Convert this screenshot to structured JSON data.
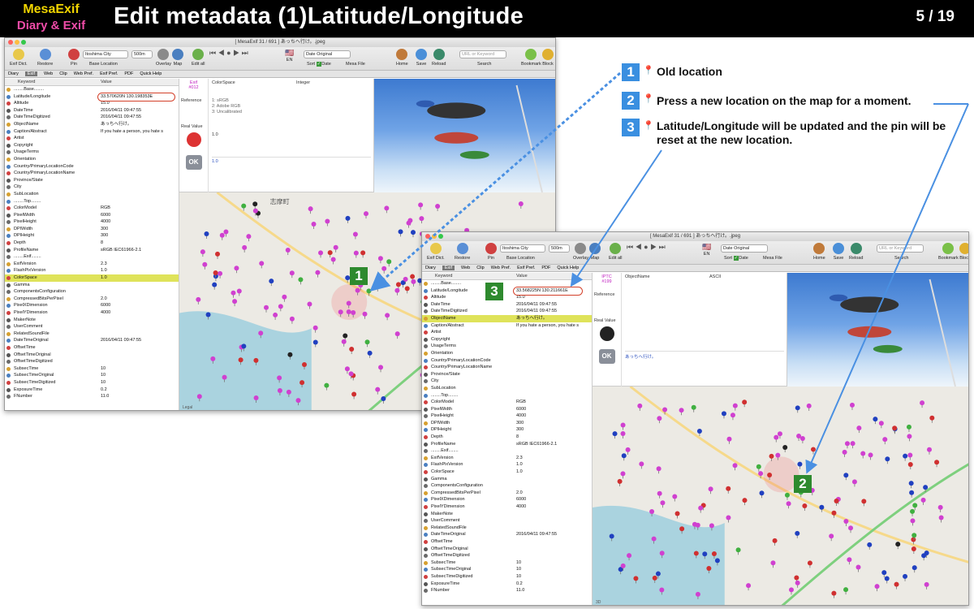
{
  "slide": {
    "brand_line1": "MesaExif",
    "brand_line2": "Diary & Exif",
    "title": "Edit metadata (1)Latitude/Longitude",
    "pager": "5 / 19"
  },
  "annotations": [
    {
      "num": "1",
      "text": "Old location"
    },
    {
      "num": "2",
      "text": "Press a new location on the map for a moment."
    },
    {
      "num": "3",
      "text": "Latitude/Longitude will be updated and the pin will be reset at the new location."
    }
  ],
  "colors": {
    "badge_blue": "#3a8fe0",
    "badge_green": "#2e8a2e",
    "highlight": "#dfe35a",
    "field_circle": "#d3402a"
  },
  "win1": {
    "title": "[ MesaExif 31 / 691 ]  あっちへ行け。.jpeg",
    "toolbar": {
      "exif_dict": "Exif Dict.",
      "restore": "Restore",
      "pin": "Pin",
      "location_value": "Itoshima City",
      "base_location": "Base Location",
      "zoom_value": "500m",
      "overlay": "Overlay",
      "map": "Map",
      "edit_all": "Edit all",
      "lang": "EN",
      "sort_value": "Date Original",
      "sort": "Sort",
      "date": "Date",
      "mesa_file": "Mesa File",
      "home": "Home",
      "save": "Save",
      "reload": "Reload",
      "search_placeholder": "URL or Keyword",
      "search": "Search",
      "bookmark": "Bookmark",
      "block": "Block"
    },
    "tabs": [
      "Diary",
      "Exif",
      "Web",
      "Clip",
      "Web Pref.",
      "Exif Pref.",
      "PDF",
      "Quick Help"
    ],
    "col_keyword": "Keyword",
    "col_value": "Value",
    "rows": [
      {
        "k": "........Base........",
        "v": ""
      },
      {
        "k": "Latitude/Longitude",
        "v": "33.570620N 130.198353E"
      },
      {
        "k": "Altitude",
        "v": "15.0"
      },
      {
        "k": "DateTime",
        "v": "2016/04/11 09:47:55"
      },
      {
        "k": "DateTimeDigitized",
        "v": "2016/04/11 09:47:55"
      },
      {
        "k": "ObjectName",
        "v": "あっちへ行け。"
      },
      {
        "k": "Caption/Abstract",
        "v": "If you hate a person, you hate s"
      },
      {
        "k": "Artist",
        "v": ""
      },
      {
        "k": "Copyright",
        "v": ""
      },
      {
        "k": "UsageTerms",
        "v": ""
      },
      {
        "k": "Orientation",
        "v": ""
      },
      {
        "k": "Country/PrimaryLocationCode",
        "v": ""
      },
      {
        "k": "Country/PrimaryLocationName",
        "v": ""
      },
      {
        "k": "Province/State",
        "v": ""
      },
      {
        "k": "City",
        "v": ""
      },
      {
        "k": "SubLocation",
        "v": ""
      },
      {
        "k": "........Top........",
        "v": ""
      },
      {
        "k": "ColorModel",
        "v": "RGB"
      },
      {
        "k": "PixelWidth",
        "v": "6000"
      },
      {
        "k": "PixelHeight",
        "v": "4000"
      },
      {
        "k": "DPIWidth",
        "v": "300"
      },
      {
        "k": "DPIHeight",
        "v": "300"
      },
      {
        "k": "Depth",
        "v": "8"
      },
      {
        "k": "ProfileName",
        "v": "sRGB IEC61966-2.1"
      },
      {
        "k": "........Exif........",
        "v": ""
      },
      {
        "k": "ExifVersion",
        "v": "2.3"
      },
      {
        "k": "FlashPixVersion",
        "v": "1.0"
      },
      {
        "k": "ColorSpace",
        "v": "1.0"
      },
      {
        "k": "Gamma",
        "v": ""
      },
      {
        "k": "ComponentsConfiguration",
        "v": ""
      },
      {
        "k": "CompressedBitsPerPixel",
        "v": "2.0"
      },
      {
        "k": "PixelXDimension",
        "v": "6000"
      },
      {
        "k": "PixelYDimension",
        "v": "4000"
      },
      {
        "k": "MakerNote",
        "v": ""
      },
      {
        "k": "UserComment",
        "v": ""
      },
      {
        "k": "RelatedSoundFile",
        "v": ""
      },
      {
        "k": "DateTimeOriginal",
        "v": "2016/04/11 09:47:55"
      },
      {
        "k": "OffsetTime",
        "v": ""
      },
      {
        "k": "OffsetTimeOriginal",
        "v": ""
      },
      {
        "k": "OffsetTimeDigitized",
        "v": ""
      },
      {
        "k": "SubsecTime",
        "v": "10"
      },
      {
        "k": "SubsecTimeOriginal",
        "v": "10"
      },
      {
        "k": "SubsecTimeDigitized",
        "v": "10"
      },
      {
        "k": "ExposureTime",
        "v": "0.2"
      },
      {
        "k": "FNumber",
        "v": "11.0"
      }
    ],
    "detail": {
      "section": "Exif",
      "tag": "#012",
      "field": "ColorSpace",
      "type": "Integer",
      "reference_label": "Reference",
      "reference_lines": [
        "1: sRGB",
        "2: Adobe RGB",
        "3: Uncalibrated"
      ],
      "real_value_label": "Real Value",
      "real_value": "1.0",
      "value": "1.0",
      "ok": "OK"
    },
    "map_label": "志摩町",
    "map_corner": "Legal"
  },
  "win2": {
    "title": "[ MesaExif 31 / 691 ]  あっちへ行け。.jpeg",
    "toolbar": {
      "exif_dict": "Exif Dict.",
      "restore": "Restore",
      "pin": "Pin",
      "location_value": "Itoshima City",
      "base_location": "Base Location",
      "zoom_value": "500m",
      "overlay": "Overlay",
      "map": "Map",
      "edit_all": "Edit all",
      "lang": "EN",
      "sort_value": "Date Original",
      "sort": "Sort",
      "date": "Date",
      "mesa_file": "Mesa File",
      "home": "Home",
      "save": "Save",
      "reload": "Reload",
      "search_placeholder": "URL or Keyword",
      "search": "Search",
      "bookmark": "Bookmark",
      "block": "Block"
    },
    "tabs": [
      "Diary",
      "Exif",
      "Web",
      "Clip",
      "Web Pref.",
      "Exif Pref.",
      "PDF",
      "Quick Help"
    ],
    "col_keyword": "Keyword",
    "col_value": "Value",
    "rows": [
      {
        "k": "........Base........",
        "v": ""
      },
      {
        "k": "Latitude/Longitude",
        "v": "33.568225N 130.211661E"
      },
      {
        "k": "Altitude",
        "v": "15.0"
      },
      {
        "k": "DateTime",
        "v": "2016/04/11 09:47:55"
      },
      {
        "k": "DateTimeDigitized",
        "v": "2016/04/11 09:47:55"
      },
      {
        "k": "ObjectName",
        "v": "あっちへ行け。"
      },
      {
        "k": "Caption/Abstract",
        "v": "If you hate a person, you hate s"
      },
      {
        "k": "Artist",
        "v": ""
      },
      {
        "k": "Copyright",
        "v": ""
      },
      {
        "k": "UsageTerms",
        "v": ""
      },
      {
        "k": "Orientation",
        "v": ""
      },
      {
        "k": "Country/PrimaryLocationCode",
        "v": ""
      },
      {
        "k": "Country/PrimaryLocationName",
        "v": ""
      },
      {
        "k": "Province/State",
        "v": ""
      },
      {
        "k": "City",
        "v": ""
      },
      {
        "k": "SubLocation",
        "v": ""
      },
      {
        "k": "........Top........",
        "v": ""
      },
      {
        "k": "ColorModel",
        "v": "RGB"
      },
      {
        "k": "PixelWidth",
        "v": "6000"
      },
      {
        "k": "PixelHeight",
        "v": "4000"
      },
      {
        "k": "DPIWidth",
        "v": "300"
      },
      {
        "k": "DPIHeight",
        "v": "300"
      },
      {
        "k": "Depth",
        "v": "8"
      },
      {
        "k": "ProfileName",
        "v": "sRGB IEC61966-2.1"
      },
      {
        "k": "........Exif........",
        "v": ""
      },
      {
        "k": "ExifVersion",
        "v": "2.3"
      },
      {
        "k": "FlashPixVersion",
        "v": "1.0"
      },
      {
        "k": "ColorSpace",
        "v": "1.0"
      },
      {
        "k": "Gamma",
        "v": ""
      },
      {
        "k": "ComponentsConfiguration",
        "v": ""
      },
      {
        "k": "CompressedBitsPerPixel",
        "v": "2.0"
      },
      {
        "k": "PixelXDimension",
        "v": "6000"
      },
      {
        "k": "PixelYDimension",
        "v": "4000"
      },
      {
        "k": "MakerNote",
        "v": ""
      },
      {
        "k": "UserComment",
        "v": ""
      },
      {
        "k": "RelatedSoundFile",
        "v": ""
      },
      {
        "k": "DateTimeOriginal",
        "v": "2016/04/11 09:47:55"
      },
      {
        "k": "OffsetTime",
        "v": ""
      },
      {
        "k": "OffsetTimeOriginal",
        "v": ""
      },
      {
        "k": "OffsetTimeDigitized",
        "v": ""
      },
      {
        "k": "SubsecTime",
        "v": "10"
      },
      {
        "k": "SubsecTimeOriginal",
        "v": "10"
      },
      {
        "k": "SubsecTimeDigitized",
        "v": "10"
      },
      {
        "k": "ExposureTime",
        "v": "0.2"
      },
      {
        "k": "FNumber",
        "v": "11.0"
      }
    ],
    "detail": {
      "section": "IPTC",
      "tag": "#199",
      "field": "ObjectName",
      "type": "ASCII",
      "reference_label": "Reference",
      "real_value_label": "Real Value",
      "value": "あっちへ行け。",
      "ok": "OK"
    },
    "map_corner": "3D"
  }
}
